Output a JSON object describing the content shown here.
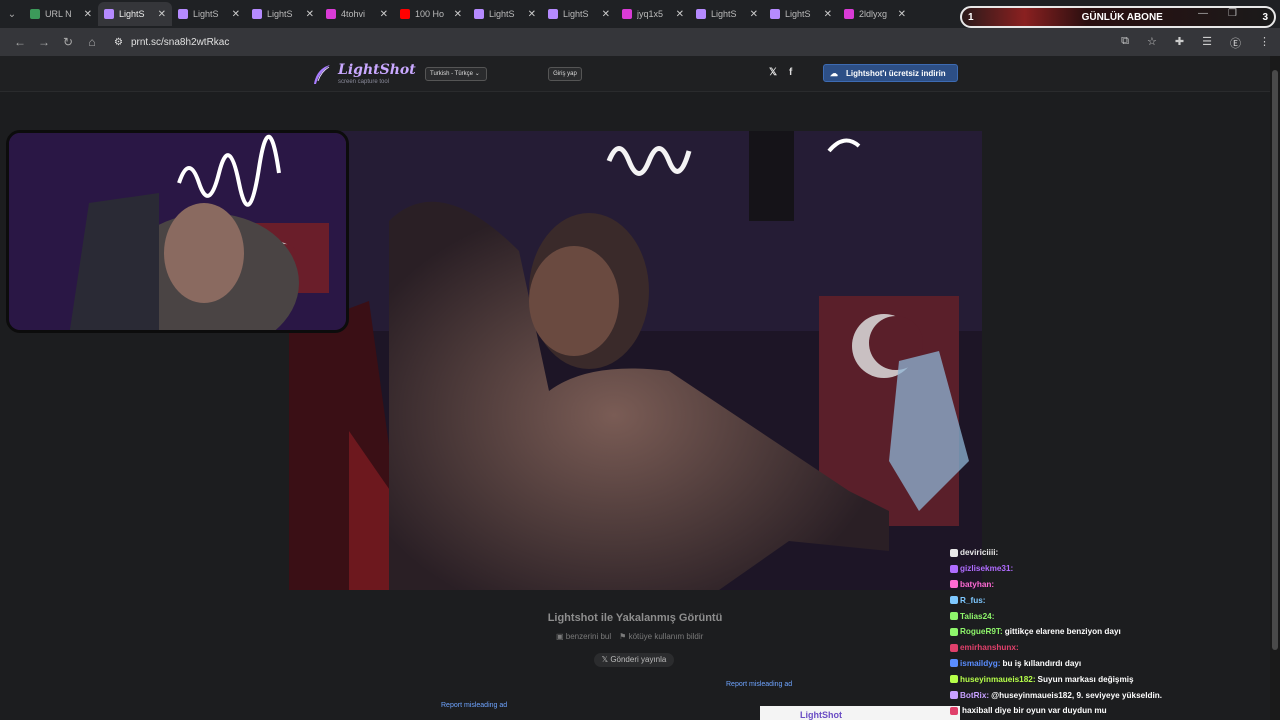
{
  "browser": {
    "tabs": [
      {
        "title": "URL N",
        "favicon": "globe-icon",
        "favicon_color": "#3c9a5a",
        "active": false
      },
      {
        "title": "LightS",
        "favicon": "feather-icon",
        "favicon_color": "#b58aff",
        "active": true
      },
      {
        "title": "LightS",
        "favicon": "feather-icon",
        "favicon_color": "#b58aff",
        "active": false
      },
      {
        "title": "LightS",
        "favicon": "feather-icon",
        "favicon_color": "#b58aff",
        "active": false
      },
      {
        "title": "4tohvi",
        "favicon": "hashtag-icon",
        "favicon_color": "#d93bd6",
        "active": false
      },
      {
        "title": "100 Ho",
        "favicon": "youtube-icon",
        "favicon_color": "#ff0000",
        "active": false
      },
      {
        "title": "LightS",
        "favicon": "feather-icon",
        "favicon_color": "#b58aff",
        "active": false
      },
      {
        "title": "LightS",
        "favicon": "feather-icon",
        "favicon_color": "#b58aff",
        "active": false
      },
      {
        "title": "jyq1x5",
        "favicon": "hashtag-icon",
        "favicon_color": "#d93bd6",
        "active": false
      },
      {
        "title": "LightS",
        "favicon": "feather-icon",
        "favicon_color": "#b58aff",
        "active": false
      },
      {
        "title": "LightS",
        "favicon": "feather-icon",
        "favicon_color": "#b58aff",
        "active": false
      },
      {
        "title": "2ldlyxg",
        "favicon": "hashtag-icon",
        "favicon_color": "#d93bd6",
        "active": false
      }
    ],
    "url": "prnt.sc/sna8h2wtRkac"
  },
  "stream_banner": {
    "left_number": "1",
    "title": "GÜNLÜK ABONE",
    "right_number": "3"
  },
  "lightshot": {
    "logo_name": "LightShot",
    "logo_tagline": "screen capture tool",
    "language": "Turkish - Türkçe",
    "login": "Giriş yap",
    "download": "Lightshot'ı ücretsiz indirin",
    "image_title": "Lightshot ile Yakalanmış Görüntü",
    "find_similar": "benzerini bul",
    "report_abuse": "kötüye kullanım bildir",
    "post_button": "Gönderi yayınla",
    "report_ad": "Report misleading ad",
    "ad_brand": "LightShot"
  },
  "chat": [
    {
      "user": "devirici​iii:",
      "text": "",
      "color": "#e8e8e8"
    },
    {
      "user": "gizlisekme31:",
      "text": "",
      "color": "#b06cff"
    },
    {
      "user": "batyhan:",
      "text": "",
      "color": "#ff6ad5"
    },
    {
      "user": "R_fus:",
      "text": "",
      "color": "#7ec8ff"
    },
    {
      "user": "Talias24:",
      "text": "",
      "color": "#8ef56b"
    },
    {
      "user": "RogueR9T:",
      "text": "gittikçe elarene benziyon dayı",
      "color": "#8ef56b"
    },
    {
      "user": "emirhanshunx:",
      "text": "",
      "color": "#e0406b"
    },
    {
      "user": "ismaildyg:",
      "text": "bu iş kıllandırdı dayı",
      "color": "#5a8dff"
    },
    {
      "user": "huseyinmaueis182:",
      "text": "Suyun markası değişmiş",
      "color": "#b6ff4a"
    },
    {
      "user": "BotRix:",
      "text": "@huseyinmaueis182, 9. seviyeye yükseldin.",
      "color": "#c7a0ff"
    },
    {
      "user": "",
      "text": "haxiball diye bir oyun var duydun mu",
      "color": "#e0406b"
    }
  ]
}
